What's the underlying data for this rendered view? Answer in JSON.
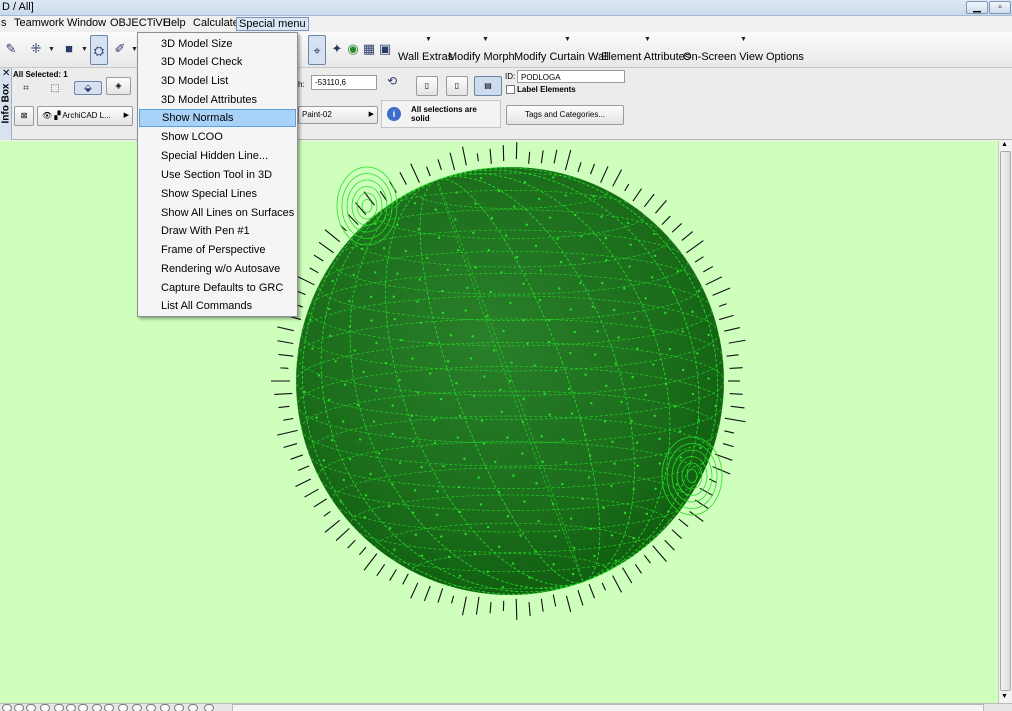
{
  "window": {
    "title": "D / All]",
    "minimize_icon": "minimize-icon",
    "maximize_icon": "maximize-icon"
  },
  "menubar": {
    "items": [
      "s",
      "Teamwork",
      "Window",
      "OBJECTiVE",
      "Help",
      "Calculate",
      "Special menu"
    ],
    "open_menu": "Special menu"
  },
  "toolbar": {
    "text_items": [
      "Wall Extras",
      "Modify Morph",
      "Modify Curtain Wall",
      "Element Attributes",
      "On-Screen View Options"
    ]
  },
  "special_menu": {
    "items": [
      "3D Model Size",
      "3D Model Check",
      "3D Model List",
      "3D Model Attributes",
      "Show Normals",
      "Show LCOO",
      "Special Hidden Line...",
      "Use Section Tool in 3D",
      "Show Special Lines",
      "Show All Lines on Surfaces",
      "Draw With Pen #1",
      "Frame of Perspective",
      "Rendering w/o Autosave",
      "Capture Defaults to GRC",
      "List All Commands"
    ],
    "highlighted": "Show Normals"
  },
  "infobox": {
    "tab_label": "Info Box",
    "selection_label": "All Selected: 1",
    "layer_value": "ArchiCAD L...",
    "height_label": "h:",
    "height_value": "-53110,6",
    "material_value": "Paint-02",
    "solid_note": "All selections are solid",
    "id_label": "ID:",
    "id_value": "PODLOGA",
    "label_elements": "Label Elements",
    "label_elements_checked": false,
    "tags_button": "Tags and Categories..."
  },
  "viewport": {
    "background_color": "#cfffbd",
    "sphere_color": "#1c6b1c",
    "mesh_color": "#25e025",
    "normal_color": "#111111"
  },
  "colors": {
    "menu_highlight": "#a8d2f7",
    "open_menu": "#dbe7f6"
  }
}
